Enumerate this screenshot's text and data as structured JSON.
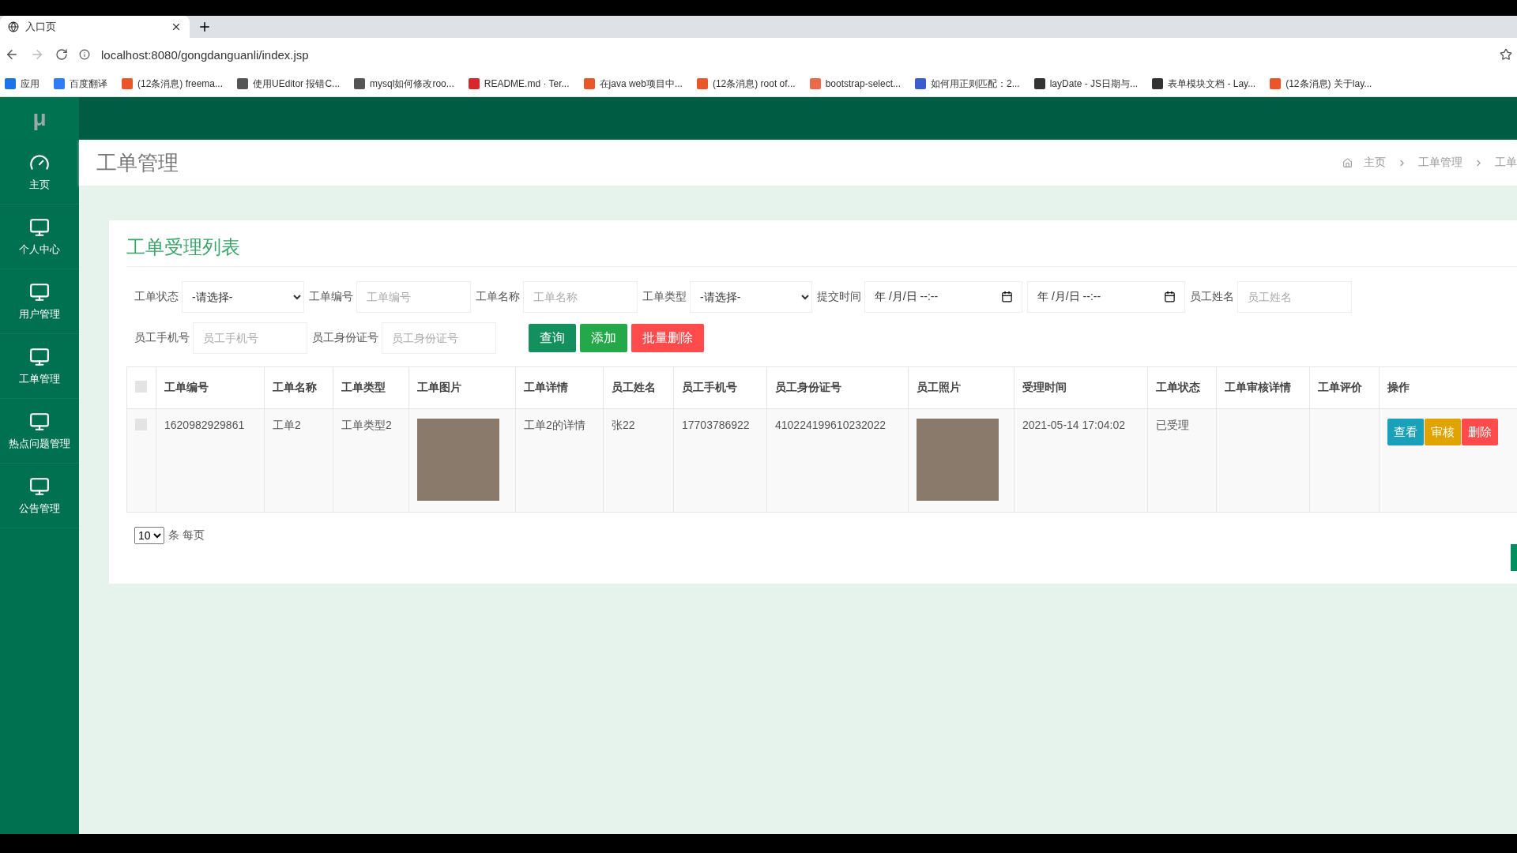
{
  "browser": {
    "tab_title": "入口页",
    "url": "localhost:8080/gongdanguanli/index.jsp",
    "bookmarks": [
      {
        "label": "应用",
        "color": "#1a73e8"
      },
      {
        "label": "百度翻译",
        "color": "#2f7cf6"
      },
      {
        "label": "(12条消息) freema...",
        "color": "#e8562a"
      },
      {
        "label": "使用UEditor 报错C...",
        "color": "#555555"
      },
      {
        "label": "mysql如何修改roo...",
        "color": "#555555"
      },
      {
        "label": "README.md · Ter...",
        "color": "#d9262c"
      },
      {
        "label": "在java web项目中...",
        "color": "#e8562a"
      },
      {
        "label": "(12条消息) root of...",
        "color": "#e8562a"
      },
      {
        "label": "bootstrap-select...",
        "color": "#e86a4a"
      },
      {
        "label": "如何用正则匹配：2...",
        "color": "#3b5ccf"
      },
      {
        "label": "layDate - JS日期与...",
        "color": "#333333"
      },
      {
        "label": "表单模块文档 - Lay...",
        "color": "#333333"
      },
      {
        "label": "(12条消息) 关于lay...",
        "color": "#e8562a"
      }
    ]
  },
  "app": {
    "logo": "μ",
    "page_title": "工单管理",
    "breadcrumb": [
      "主页",
      "工单管理",
      "工单"
    ]
  },
  "sidebar": {
    "items": [
      {
        "label": "主页",
        "kind": "gauge",
        "selected": false
      },
      {
        "label": "个人中心",
        "kind": "monitor",
        "selected": false
      },
      {
        "label": "用户管理",
        "kind": "monitor",
        "selected": false
      },
      {
        "label": "工单管理",
        "kind": "monitor",
        "selected": false
      },
      {
        "label": "热点问题管理",
        "kind": "monitor",
        "selected": false
      },
      {
        "label": "公告管理",
        "kind": "monitor",
        "selected": false
      }
    ]
  },
  "card": {
    "title": "工单受理列表",
    "filter_rows": [
      [
        {
          "label": "工单状态",
          "kind": "select",
          "value": "-请选择-"
        },
        {
          "label": "工单编号",
          "kind": "text",
          "placeholder": "工单编号"
        },
        {
          "label": "工单名称",
          "kind": "text",
          "placeholder": "工单名称"
        },
        {
          "label": "工单类型",
          "kind": "select",
          "value": "-请选择-"
        },
        {
          "label": "提交时间",
          "kind": "date",
          "value": "年 /月/日 --:--"
        },
        {
          "kind": "date",
          "value": "年 /月/日 --:--"
        },
        {
          "label": "员工姓名",
          "kind": "text",
          "placeholder": "员工姓名"
        }
      ],
      [
        {
          "label": "员工手机号",
          "kind": "text",
          "placeholder": "员工手机号"
        },
        {
          "label": "员工身份证号",
          "kind": "text",
          "placeholder": "员工身份证号"
        }
      ]
    ],
    "buttons": [
      {
        "label": "查询",
        "kind": "search"
      },
      {
        "label": "添加",
        "kind": "add"
      },
      {
        "label": "批量删除",
        "kind": "delete"
      }
    ],
    "table": {
      "header_checked": false,
      "columns": [
        "工单编号",
        "工单名称",
        "工单类型",
        "工单图片",
        "工单详情",
        "员工姓名",
        "员工手机号",
        "员工身份证号",
        "员工照片",
        "受理时间",
        "工单状态",
        "工单审核详情",
        "工单评价",
        "操作"
      ],
      "rows": [
        {
          "checked": false,
          "cells": [
            "1620982929861",
            "工单2",
            "工单类型2",
            null,
            "工单2的详情",
            "张22",
            "17703786922",
            "410224199610232022",
            null,
            "2021-05-14 17:04:02",
            "已受理",
            "",
            ""
          ],
          "actions": [
            {
              "label": "查看",
              "kind": "view"
            },
            {
              "label": "审核",
              "kind": "review"
            },
            {
              "label": "删除",
              "kind": "delete"
            }
          ]
        }
      ]
    },
    "page_size": "10",
    "page_size_label": "条 每页"
  }
}
